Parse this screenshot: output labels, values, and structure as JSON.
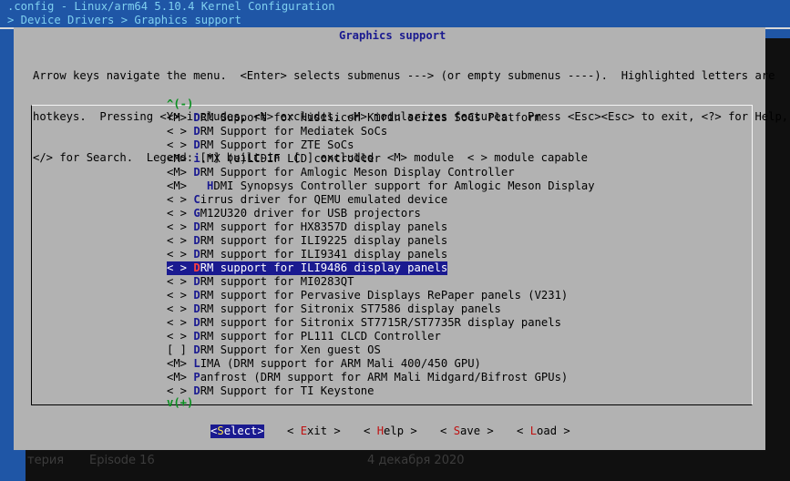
{
  "terminal": {
    "title": ".config - Linux/arm64 5.10.4 Kernel Configuration",
    "breadcrumb": "> Device Drivers > Graphics support"
  },
  "dialog": {
    "title": "Graphics support",
    "help_lines": [
      "Arrow keys navigate the menu.  <Enter> selects submenus ---> (or empty submenus ----).  Highlighted letters are",
      "hotkeys.  Pressing <Y> includes, <N> excludes, <M> modularizes features.  Press <Esc><Esc> to exit, <?> for Help,",
      "</> for Search.  Legend: [*] built-in  [ ] excluded  <M> module  < > module capable"
    ],
    "scroll_up": "^(-)",
    "scroll_down": "v(+)"
  },
  "menu": {
    "items": [
      {
        "state": "<M>",
        "pre": " ",
        "hotkey": "D",
        "rest": "RM Support for Hisilicon Kirin series SoCs Platform"
      },
      {
        "state": "< >",
        "pre": " ",
        "hotkey": "D",
        "rest": "RM Support for Mediatek SoCs"
      },
      {
        "state": "< >",
        "pre": " ",
        "hotkey": "D",
        "rest": "RM Support for ZTE SoCs"
      },
      {
        "state": "<M>",
        "pre": " ",
        "hotkey": "i",
        "rest": ".MX (e)LCDIF LCD controller"
      },
      {
        "state": "<M>",
        "pre": " ",
        "hotkey": "D",
        "rest": "RM Support for Amlogic Meson Display Controller"
      },
      {
        "state": "<M>",
        "pre": "   ",
        "hotkey": "H",
        "rest": "DMI Synopsys Controller support for Amlogic Meson Display"
      },
      {
        "state": "< >",
        "pre": " ",
        "hotkey": "C",
        "rest": "irrus driver for QEMU emulated device"
      },
      {
        "state": "< >",
        "pre": " ",
        "hotkey": "G",
        "rest": "M12U320 driver for USB projectors"
      },
      {
        "state": "< >",
        "pre": " ",
        "hotkey": "D",
        "rest": "RM support for HX8357D display panels"
      },
      {
        "state": "< >",
        "pre": " ",
        "hotkey": "D",
        "rest": "RM support for ILI9225 display panels"
      },
      {
        "state": "< >",
        "pre": " ",
        "hotkey": "D",
        "rest": "RM support for ILI9341 display panels"
      },
      {
        "state": "< >",
        "pre": " ",
        "hotkey": "D",
        "rest": "RM support for ILI9486 display panels",
        "selected": true
      },
      {
        "state": "< >",
        "pre": " ",
        "hotkey": "D",
        "rest": "RM support for MI0283QT"
      },
      {
        "state": "< >",
        "pre": " ",
        "hotkey": "D",
        "rest": "RM support for Pervasive Displays RePaper panels (V231)"
      },
      {
        "state": "< >",
        "pre": " ",
        "hotkey": "D",
        "rest": "RM support for Sitronix ST7586 display panels"
      },
      {
        "state": "< >",
        "pre": " ",
        "hotkey": "D",
        "rest": "RM support for Sitronix ST7715R/ST7735R display panels"
      },
      {
        "state": "< >",
        "pre": " ",
        "hotkey": "D",
        "rest": "RM support for PL111 CLCD Controller"
      },
      {
        "state": "[ ]",
        "pre": " ",
        "hotkey": "D",
        "rest": "RM Support for Xen guest OS"
      },
      {
        "state": "<M>",
        "pre": " ",
        "hotkey": "L",
        "rest": "IMA (DRM support for ARM Mali 400/450 GPU)"
      },
      {
        "state": "<M>",
        "pre": " ",
        "hotkey": "P",
        "rest": "anfrost (DRM support for ARM Mali Midgard/Bifrost GPUs)"
      },
      {
        "state": "< >",
        "pre": " ",
        "hotkey": "D",
        "rest": "RM Support for TI Keystone"
      }
    ]
  },
  "buttons": [
    {
      "name": "select",
      "open": "<",
      "hotkey": "S",
      "rest": "elect",
      "close": ">",
      "active": true
    },
    {
      "name": "exit",
      "open": "< ",
      "hotkey": "E",
      "rest": "xit",
      "close": " >"
    },
    {
      "name": "help",
      "open": "< ",
      "hotkey": "H",
      "rest": "elp",
      "close": " >"
    },
    {
      "name": "save",
      "open": "< ",
      "hotkey": "S",
      "rest": "ave",
      "close": " >"
    },
    {
      "name": "load",
      "open": "< ",
      "hotkey": "L",
      "rest": "oad",
      "close": " >"
    }
  ],
  "background_window": {
    "text_1": "терия",
    "text_2": "Episode 16",
    "text_3": "4 декабря 2020"
  }
}
